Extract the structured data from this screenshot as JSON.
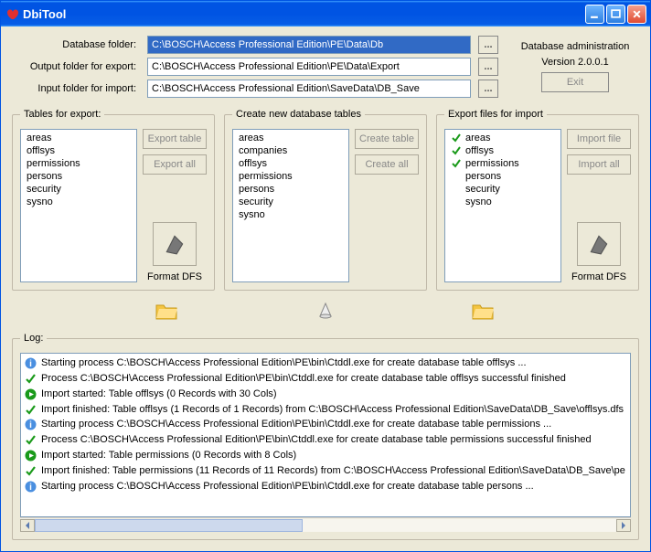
{
  "window": {
    "title": "DbiTool"
  },
  "paths": {
    "dbfolder_label": "Database folder:",
    "dbfolder_value": "C:\\BOSCH\\Access Professional Edition\\PE\\Data\\Db",
    "outfolder_label": "Output folder for export:",
    "outfolder_value": "C:\\BOSCH\\Access Professional Edition\\PE\\Data\\Export",
    "infolder_label": "Input folder for import:",
    "infolder_value": "C:\\BOSCH\\Access Professional Edition\\SaveData\\DB_Save",
    "browse_label": "..."
  },
  "admin": {
    "line1": "Database administration",
    "line2": "Version 2.0.0.1",
    "exit_label": "Exit"
  },
  "export_panel": {
    "legend": "Tables for export:",
    "items": [
      "areas",
      "offlsys",
      "permissions",
      "persons",
      "security",
      "sysno"
    ],
    "btn_export_table": "Export table",
    "btn_export_all": "Export all",
    "format_label": "Format DFS"
  },
  "create_panel": {
    "legend": "Create new database tables",
    "items": [
      "areas",
      "companies",
      "offlsys",
      "permissions",
      "persons",
      "security",
      "sysno"
    ],
    "btn_create_table": "Create table",
    "btn_create_all": "Create all"
  },
  "import_panel": {
    "legend": "Export files for import",
    "items": [
      {
        "label": "areas",
        "checked": true
      },
      {
        "label": "offlsys",
        "checked": true
      },
      {
        "label": "permissions",
        "checked": true
      },
      {
        "label": "persons",
        "checked": false
      },
      {
        "label": "security",
        "checked": false
      },
      {
        "label": "sysno",
        "checked": false
      }
    ],
    "btn_import_file": "Import file",
    "btn_import_all": "Import all",
    "format_label": "Format DFS"
  },
  "log": {
    "legend": "Log:",
    "rows": [
      {
        "icon": "info",
        "text": "Starting process C:\\BOSCH\\Access Professional Edition\\PE\\bin\\Ctddl.exe for create database table offlsys ..."
      },
      {
        "icon": "ok",
        "text": "Process C:\\BOSCH\\Access Professional Edition\\PE\\bin\\Ctddl.exe for create database table offlsys successful finished"
      },
      {
        "icon": "play",
        "text": "Import started: Table offlsys (0 Records with 30 Cols)"
      },
      {
        "icon": "ok",
        "text": "Import finished: Table offlsys (1 Records of 1 Records) from C:\\BOSCH\\Access Professional Edition\\SaveData\\DB_Save\\offlsys.dfs"
      },
      {
        "icon": "info",
        "text": "Starting process C:\\BOSCH\\Access Professional Edition\\PE\\bin\\Ctddl.exe for create database table permissions ..."
      },
      {
        "icon": "ok",
        "text": "Process C:\\BOSCH\\Access Professional Edition\\PE\\bin\\Ctddl.exe for create database table permissions successful finished"
      },
      {
        "icon": "play",
        "text": "Import started: Table permissions (0 Records with 8 Cols)"
      },
      {
        "icon": "ok",
        "text": "Import finished: Table permissions (11 Records of 11 Records) from C:\\BOSCH\\Access Professional Edition\\SaveData\\DB_Save\\pe"
      },
      {
        "icon": "info",
        "text": "Starting process C:\\BOSCH\\Access Professional Edition\\PE\\bin\\Ctddl.exe for create database table persons ..."
      }
    ]
  }
}
